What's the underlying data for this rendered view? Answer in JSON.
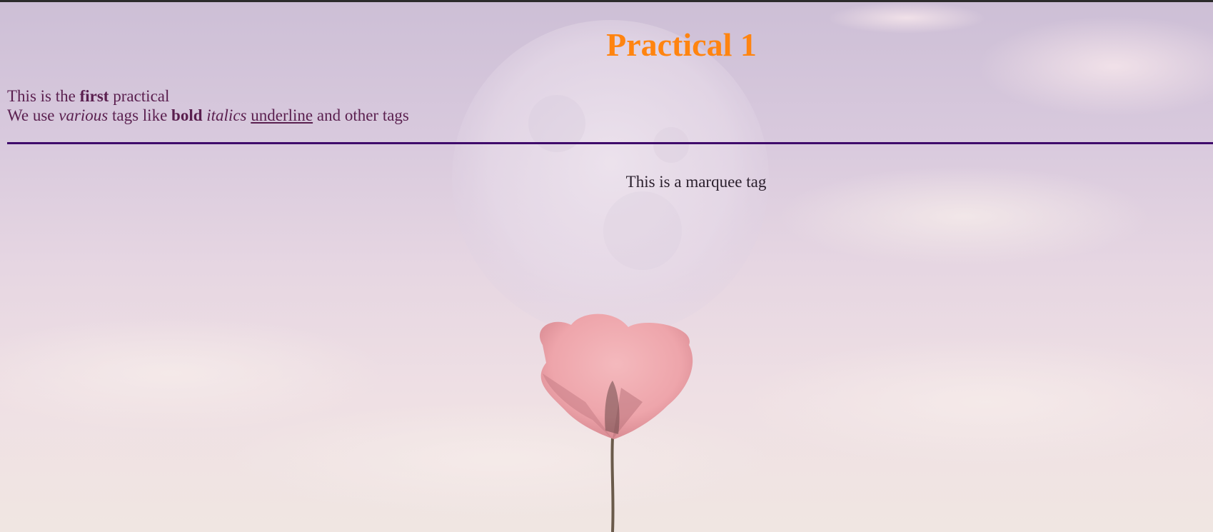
{
  "heading": "Practical 1",
  "intro": {
    "line1_pre": "This is the ",
    "line1_bold": "first",
    "line1_post": " practical",
    "line2_pre": "We use ",
    "line2_italic": "various",
    "line2_mid": " tags like ",
    "line2_bold": "bold",
    "line2_space1": " ",
    "line2_italics": "italics",
    "line2_space2": " ",
    "line2_underline": "underline",
    "line2_post": " and other tags"
  },
  "marquee_text": "This is a marquee tag",
  "colors": {
    "heading": "#ff8410",
    "text": "#5a1f4f",
    "rule": "#3f0a6b",
    "marquee": "#2a1f2c"
  },
  "background": {
    "description_icon": "moon-and-flower-image"
  }
}
